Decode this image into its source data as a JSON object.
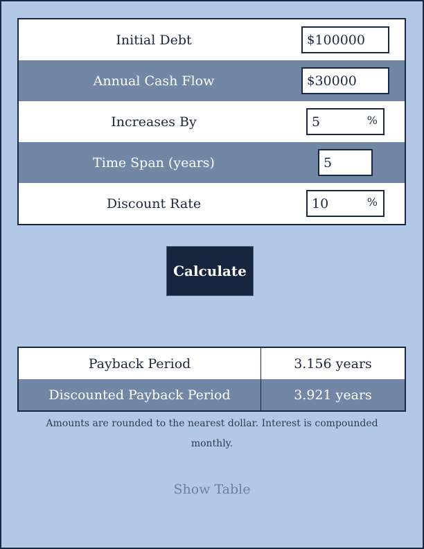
{
  "inputs": [
    {
      "label": "Initial Debt",
      "prefix": "$",
      "value": "100000",
      "suffix": ""
    },
    {
      "label": "Annual Cash Flow",
      "prefix": "$",
      "value": "30000",
      "suffix": ""
    },
    {
      "label": "Increases By",
      "prefix": "",
      "value": "5",
      "suffix": "%"
    },
    {
      "label": "Time Span (years)",
      "prefix": "",
      "value": "5",
      "suffix": ""
    },
    {
      "label": "Discount Rate",
      "prefix": "",
      "value": "10",
      "suffix": "%"
    }
  ],
  "calculate_label": "Calculate",
  "results": [
    {
      "label": "Payback Period",
      "value": "3.156 years"
    },
    {
      "label": "Discounted Payback Period",
      "value": "3.921 years"
    }
  ],
  "note": "Amounts are rounded to the nearest dollar. Interest is compounded monthly.",
  "show_table_label": "Show Table",
  "colors": {
    "background": "#b3c8e7",
    "alt_row": "#7286a5",
    "dark": "#16243d"
  }
}
